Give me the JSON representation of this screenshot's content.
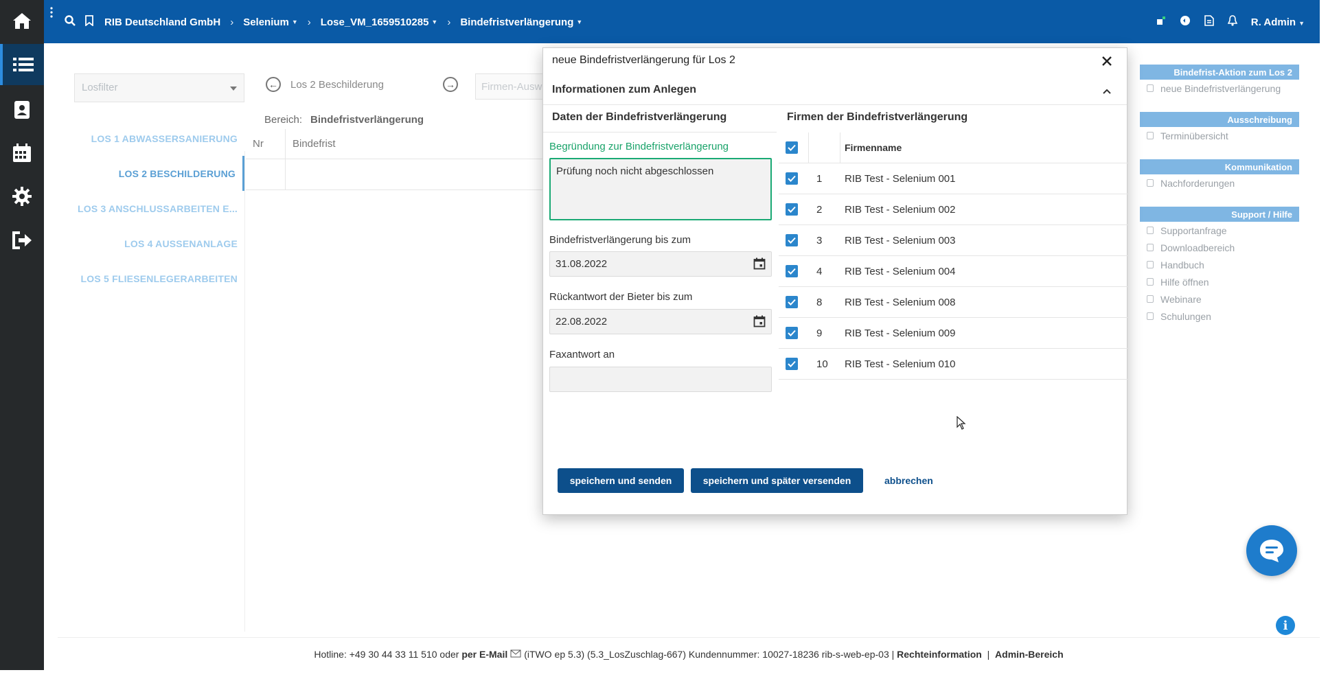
{
  "topbar": {
    "company": "RIB Deutschland GmbH",
    "project": "Selenium",
    "lose": "Lose_VM_1659510285",
    "section": "Bindefristverlängerung",
    "user": "R. Admin"
  },
  "sidebar": {
    "items": [
      "home",
      "list",
      "contacts",
      "calendar",
      "settings",
      "logout"
    ]
  },
  "losfilter": {
    "placeholder": "Losfilter"
  },
  "lots": [
    "LOS 1 ABWASSERSANIERUNG",
    "LOS 2 BESCHILDERUNG",
    "LOS 3 ANSCHLUSSARBEITEN E...",
    "LOS 4 AUSSENANLAGE",
    "LOS 5 FLIESENLEGERARBEITEN"
  ],
  "lotnav": {
    "current": "Los 2 Beschilderung",
    "firmen_placeholder": "Firmen-Ausw"
  },
  "bereich": {
    "label": "Bereich:",
    "value": "Bindefristverlängerung"
  },
  "bg_table": {
    "headers": [
      "Nr",
      "Bindefrist"
    ]
  },
  "right_panel": {
    "groups": [
      {
        "title": "Bindefrist-Aktion zum Los 2",
        "links": [
          "neue Bindefristverlängerung"
        ]
      },
      {
        "title": "Ausschreibung",
        "links": [
          "Terminübersicht"
        ]
      },
      {
        "title": "Kommunikation",
        "links": [
          "Nachforderungen"
        ]
      },
      {
        "title": "Support / Hilfe",
        "links": [
          "Supportanfrage",
          "Downloadbereich",
          "Handbuch",
          "Hilfe öffnen",
          "Webinare",
          "Schulungen"
        ]
      }
    ]
  },
  "modal": {
    "title": "neue Bindefristverlängerung für Los 2",
    "section": "Informationen zum Anlegen",
    "left_title": "Daten der Bindefristverlängerung",
    "right_title": "Firmen der Bindefristverlängerung",
    "reason_label": "Begründung zur Bindefristverlängerung",
    "reason_value": "Prüfung noch nicht abgeschlossen",
    "until_label": "Bindefristverlängerung bis zum",
    "until_value": "31.08.2022",
    "reply_label": "Rückantwort der Bieter bis zum",
    "reply_value": "22.08.2022",
    "fax_label": "Faxantwort an",
    "fax_value": "",
    "firm_header": "Firmenname",
    "firms": [
      {
        "nr": "1",
        "name": "RIB Test - Selenium 001"
      },
      {
        "nr": "2",
        "name": "RIB Test - Selenium 002"
      },
      {
        "nr": "3",
        "name": "RIB Test - Selenium 003"
      },
      {
        "nr": "4",
        "name": "RIB Test - Selenium 004"
      },
      {
        "nr": "8",
        "name": "RIB Test - Selenium 008"
      },
      {
        "nr": "9",
        "name": "RIB Test - Selenium 009"
      },
      {
        "nr": "10",
        "name": "RIB Test - Selenium 010"
      }
    ],
    "btn_send": "speichern und senden",
    "btn_later": "speichern und später versenden",
    "btn_cancel": "abbrechen"
  },
  "footer": {
    "hotline": "Hotline: +49 30 44 33 11 510 oder",
    "email": "per E-Mail",
    "version": "(iTWO ep 5.3) (5.3_LosZuschlag-667)   Kundennummer: 10027-18236 rib-s-web-ep-03 |",
    "rechte": "Rechteinformation",
    "divider": "|",
    "admin": "Admin-Bereich"
  },
  "colors": {
    "topbar": "#0a5aa6",
    "sidebar": "#26292b",
    "primary_button": "#0d4f8b",
    "accent_green": "#19a974"
  }
}
